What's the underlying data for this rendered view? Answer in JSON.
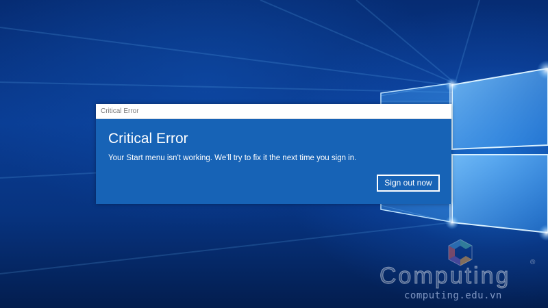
{
  "dialog": {
    "window_title": "Critical Error",
    "heading": "Critical Error",
    "message": "Your Start menu isn't working. We'll try to fix it the next time you sign in.",
    "sign_out_label": "Sign out now"
  },
  "watermark": {
    "name": "Computing",
    "registered": "®",
    "url": "computing.edu.vn"
  },
  "colors": {
    "dialog_background": "#1763b6",
    "titlebar_background": "#ffffff",
    "desktop_background": "#0a3d94",
    "windows_logo_glow": "#9fd8ff"
  },
  "icons": {
    "wallpaper": "windows-logo-icon",
    "watermark_logo": "computing-logo-icon"
  }
}
